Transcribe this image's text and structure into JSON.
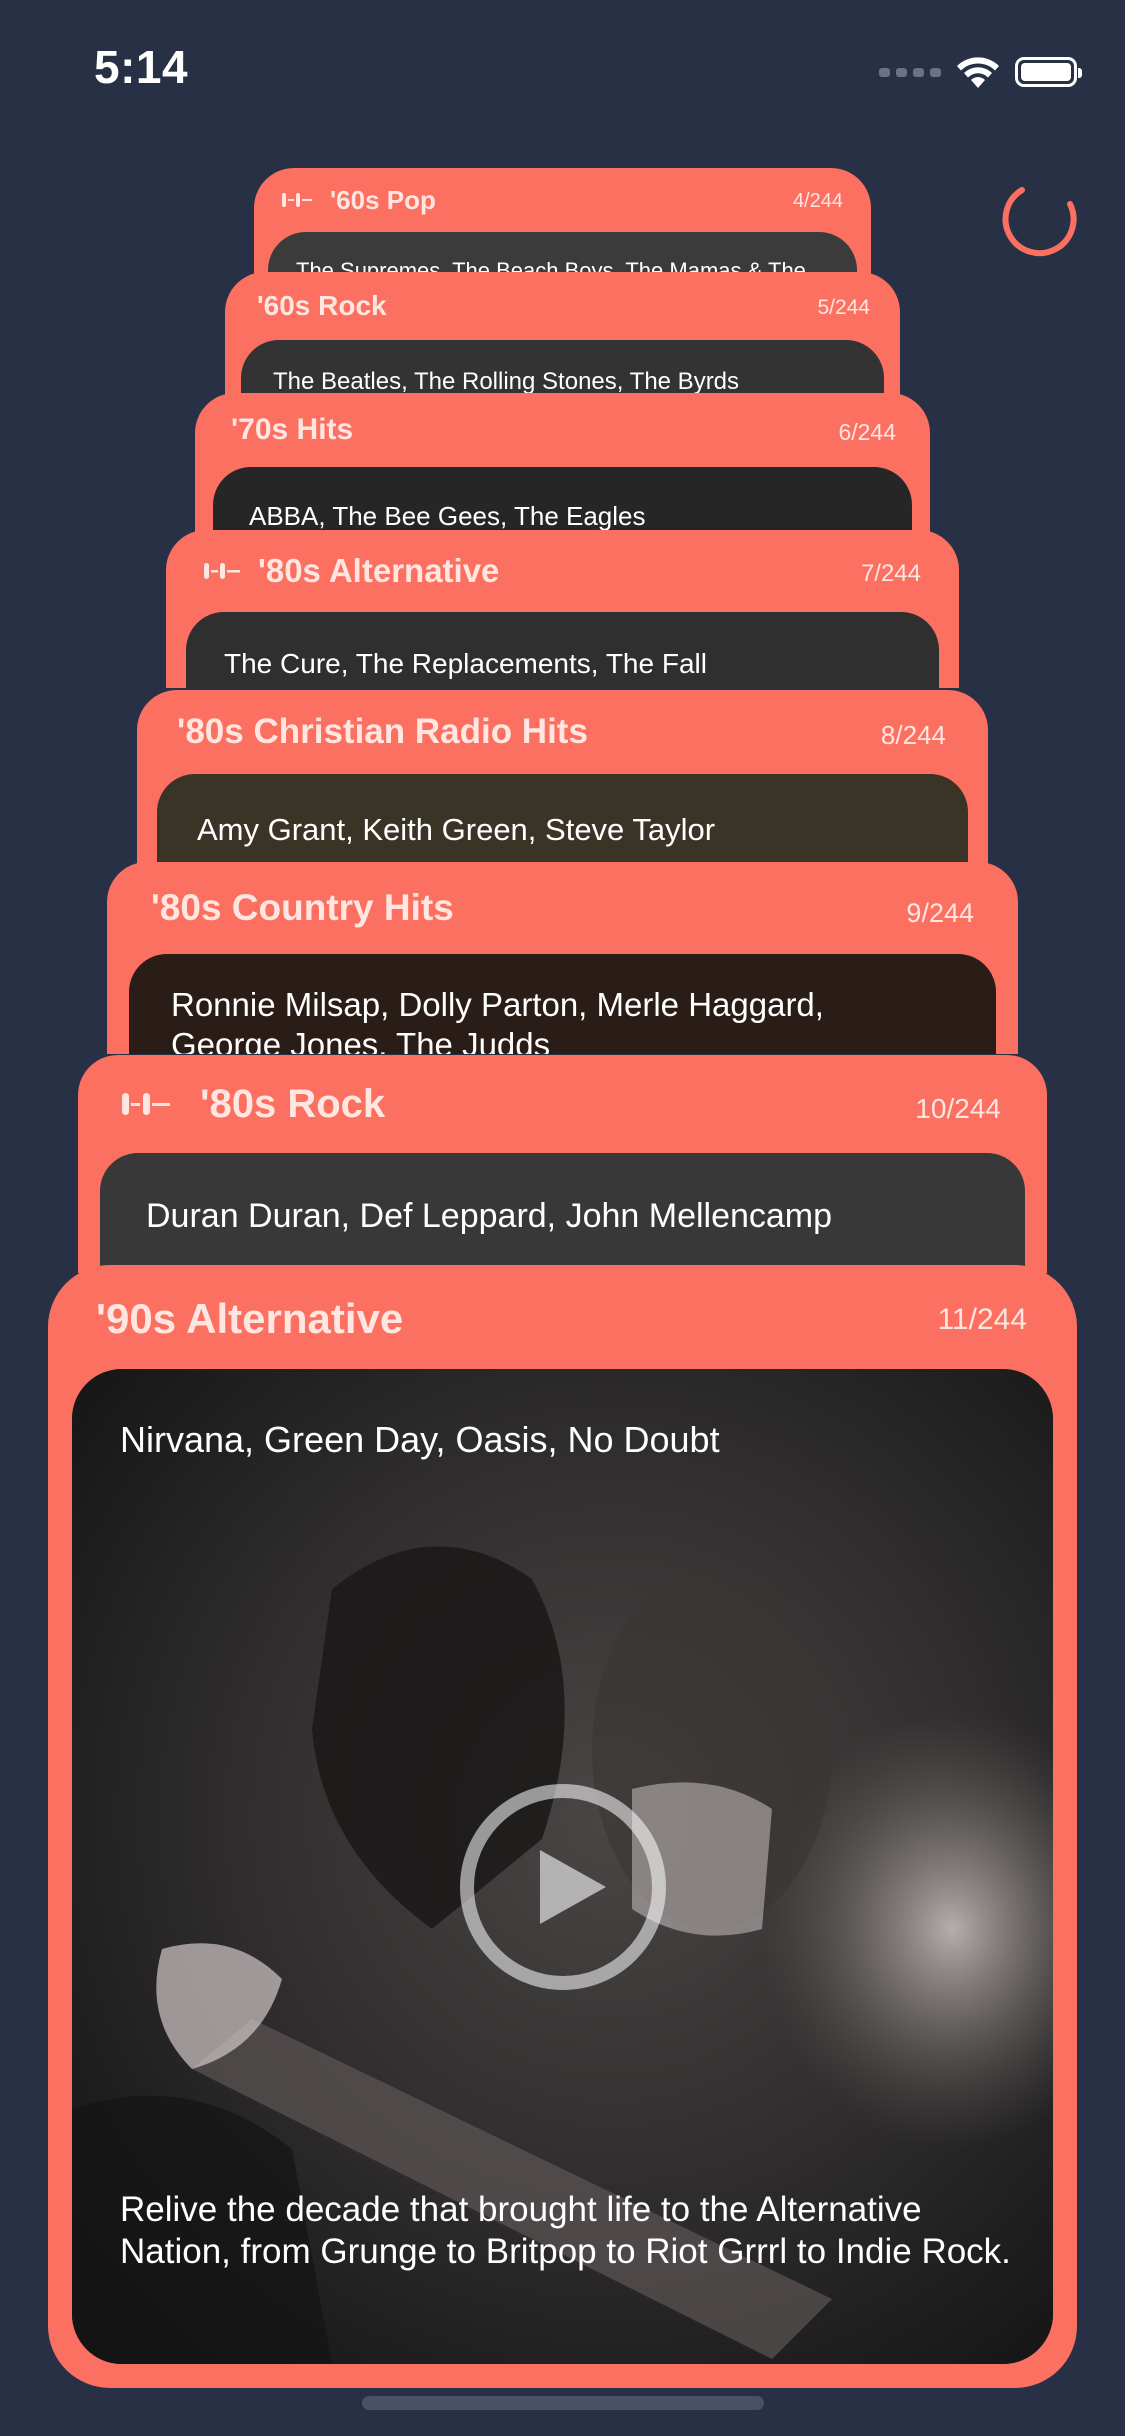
{
  "status_bar": {
    "time": "5:14"
  },
  "colors": {
    "background": "#283046",
    "card": "#fb7060",
    "card_text": "#ffe6e0"
  },
  "cards": [
    {
      "title": "'60s Pop",
      "count": "4/244",
      "artists": "The Supremes, The Beach Boys, The Mamas & The",
      "has_icon": true
    },
    {
      "title": "'60s Rock",
      "count": "5/244",
      "artists": "The Beatles, The Rolling Stones, The Byrds",
      "has_icon": false
    },
    {
      "title": "'70s Hits",
      "count": "6/244",
      "artists": "ABBA, The Bee Gees, The Eagles",
      "has_icon": false
    },
    {
      "title": "'80s Alternative",
      "count": "7/244",
      "artists": "The Cure, The Replacements, The Fall",
      "has_icon": true
    },
    {
      "title": "'80s Christian Radio Hits",
      "count": "8/244",
      "artists": "Amy Grant, Keith Green, Steve Taylor",
      "has_icon": false
    },
    {
      "title": "'80s Country Hits",
      "count": "9/244",
      "artists": "Ronnie Milsap, Dolly Parton, Merle Haggard,",
      "artists_line2": "George Jones, The Judds",
      "has_icon": false
    },
    {
      "title": "'80s Rock",
      "count": "10/244",
      "artists": "Duran Duran, Def Leppard, John Mellencamp",
      "has_icon": true
    }
  ],
  "front_card": {
    "title": "'90s Alternative",
    "count": "11/244",
    "artists": "Nirvana, Green Day, Oasis, No Doubt",
    "description": "Relive the decade that brought life to the Alternative Nation, from Grunge to Britpop to Riot Grrrl to Indie Rock."
  },
  "icons": {
    "signal": "cellular-signal-icon",
    "wifi": "wifi-icon",
    "battery": "battery-icon",
    "spinner": "loading-spinner-icon",
    "play": "play-icon",
    "pulse": "now-playing-pulse-icon"
  }
}
